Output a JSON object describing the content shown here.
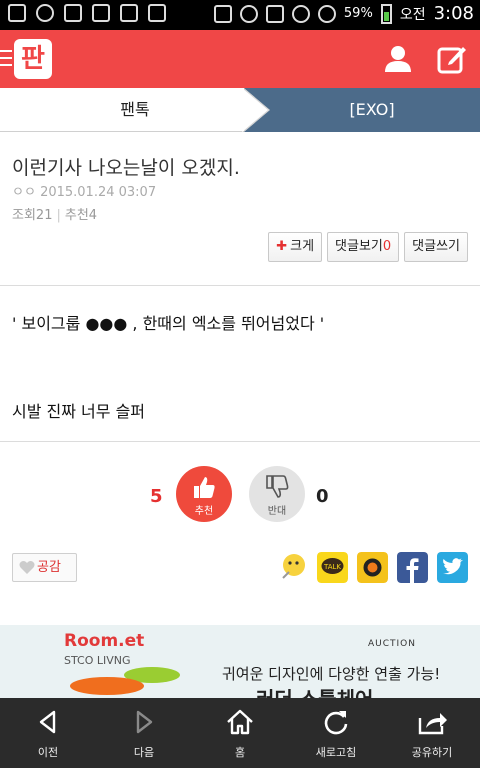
{
  "statusbar": {
    "battery_pct": "59%",
    "ampm": "오전",
    "time": "3:08"
  },
  "header": {
    "logo_text": "판"
  },
  "tabs": {
    "left": "팬톡",
    "right": "[EXO]"
  },
  "article": {
    "title": "이런기사 나오는날이 오겠지.",
    "author": "ㅇㅇ",
    "date": "2015.01.24 03:07",
    "views_label": "조회21",
    "recommend_label": "추천4",
    "body": [
      "' 보이그룹 ●●● , 한때의 엑소를 뛰어넘었다 '",
      "시발 진짜 너무 슬퍼"
    ]
  },
  "buttons": {
    "enlarge": "크게",
    "view_comments": "댓글보기",
    "comment_count": "0",
    "write_comment": "댓글쓰기"
  },
  "vote": {
    "up_count": "5",
    "up_label": "추천",
    "down_label": "반대",
    "down_count": "0"
  },
  "empathy_label": "공감",
  "ad": {
    "brand": "Room.et",
    "sub": "STCO LIVNG",
    "auction": "AUCTION",
    "copy": "귀여운 디자인에 다양한 연출 가능!",
    "copy2": "러더 스툴체어"
  },
  "bottomnav": {
    "back": "이전",
    "forward": "다음",
    "home": "홈",
    "refresh": "새로고침",
    "share": "공유하기"
  },
  "colors": {
    "brand_red": "#f04747",
    "tab_active": "#4c6b8a",
    "nav_bg": "#2b2b2b"
  }
}
